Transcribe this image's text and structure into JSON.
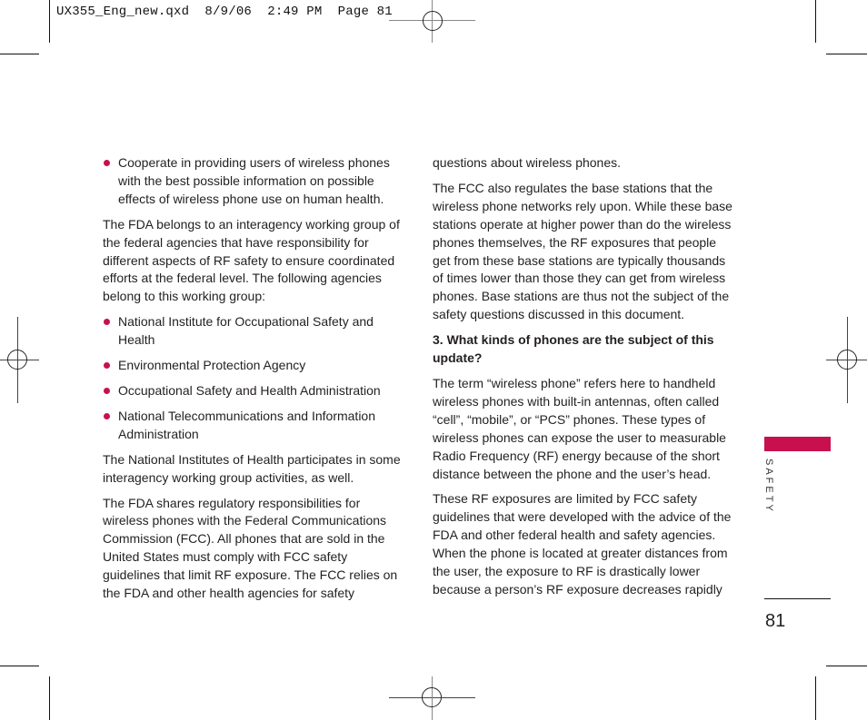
{
  "slug": {
    "text": "UX355_Eng_new.qxd  8/9/06  2:49 PM  Page 81"
  },
  "colors": {
    "accent": "#c8104e",
    "text": "#231f20"
  },
  "left_column": {
    "bullet_intro": "Cooperate in providing users of wireless phones with the best possible information on possible effects of wireless phone use on human health.",
    "para1": "The FDA belongs to an interagency working group of the federal agencies that have responsibility for different aspects of RF safety to ensure coordinated efforts at the federal level. The following agencies belong to this working group:",
    "agencies": [
      "National Institute for Occupational Safety and Health",
      "Environmental Protection Agency",
      "Occupational Safety and Health Administration",
      "National Telecommunications and Information Administration"
    ],
    "para2": "The National Institutes of Health participates in some interagency working group activities, as well.",
    "para3": "The FDA shares regulatory responsibilities for wireless phones with the Federal Communications Commission (FCC). All phones that are sold in the United States must comply with FCC safety guidelines that limit RF exposure. The FCC relies on the FDA and other health agencies for safety"
  },
  "right_column": {
    "para_cont": "questions about wireless phones.",
    "para1": "The FCC also regulates the base stations that the wireless phone networks rely upon. While these base stations operate at higher power than do the wireless phones themselves, the RF exposures that people get from these base stations are typically thousands of times lower than those they can get from wireless phones. Base stations are thus not the subject of the safety questions discussed in this document.",
    "heading": "3. What kinds of phones are the subject of this update?",
    "para2": "The term “wireless phone” refers here to handheld wireless phones with built-in antennas, often called “cell”, “mobile”, or “PCS” phones. These types of wireless phones can expose the user to measurable Radio Frequency (RF) energy because of the short distance between the phone and the user’s head.",
    "para3": "These RF exposures are limited by FCC safety guidelines that were developed with the advice of the FDA and other federal health and safety agencies. When the phone is located at greater distances from the user, the exposure to RF is drastically lower because a person’s RF exposure decreases rapidly"
  },
  "sidebar": {
    "section_label": "SAFETY",
    "page_number": "81"
  }
}
